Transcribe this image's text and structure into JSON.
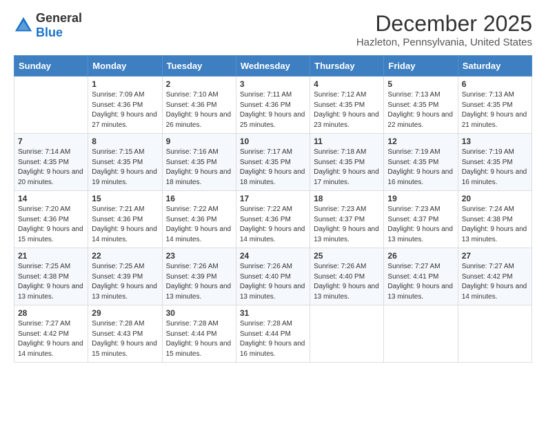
{
  "logo": {
    "general": "General",
    "blue": "Blue"
  },
  "title": "December 2025",
  "location": "Hazleton, Pennsylvania, United States",
  "days_of_week": [
    "Sunday",
    "Monday",
    "Tuesday",
    "Wednesday",
    "Thursday",
    "Friday",
    "Saturday"
  ],
  "weeks": [
    [
      {
        "day": "",
        "sunrise": "",
        "sunset": "",
        "daylight": ""
      },
      {
        "day": "1",
        "sunrise": "Sunrise: 7:09 AM",
        "sunset": "Sunset: 4:36 PM",
        "daylight": "Daylight: 9 hours and 27 minutes."
      },
      {
        "day": "2",
        "sunrise": "Sunrise: 7:10 AM",
        "sunset": "Sunset: 4:36 PM",
        "daylight": "Daylight: 9 hours and 26 minutes."
      },
      {
        "day": "3",
        "sunrise": "Sunrise: 7:11 AM",
        "sunset": "Sunset: 4:36 PM",
        "daylight": "Daylight: 9 hours and 25 minutes."
      },
      {
        "day": "4",
        "sunrise": "Sunrise: 7:12 AM",
        "sunset": "Sunset: 4:35 PM",
        "daylight": "Daylight: 9 hours and 23 minutes."
      },
      {
        "day": "5",
        "sunrise": "Sunrise: 7:13 AM",
        "sunset": "Sunset: 4:35 PM",
        "daylight": "Daylight: 9 hours and 22 minutes."
      },
      {
        "day": "6",
        "sunrise": "Sunrise: 7:13 AM",
        "sunset": "Sunset: 4:35 PM",
        "daylight": "Daylight: 9 hours and 21 minutes."
      }
    ],
    [
      {
        "day": "7",
        "sunrise": "Sunrise: 7:14 AM",
        "sunset": "Sunset: 4:35 PM",
        "daylight": "Daylight: 9 hours and 20 minutes."
      },
      {
        "day": "8",
        "sunrise": "Sunrise: 7:15 AM",
        "sunset": "Sunset: 4:35 PM",
        "daylight": "Daylight: 9 hours and 19 minutes."
      },
      {
        "day": "9",
        "sunrise": "Sunrise: 7:16 AM",
        "sunset": "Sunset: 4:35 PM",
        "daylight": "Daylight: 9 hours and 18 minutes."
      },
      {
        "day": "10",
        "sunrise": "Sunrise: 7:17 AM",
        "sunset": "Sunset: 4:35 PM",
        "daylight": "Daylight: 9 hours and 18 minutes."
      },
      {
        "day": "11",
        "sunrise": "Sunrise: 7:18 AM",
        "sunset": "Sunset: 4:35 PM",
        "daylight": "Daylight: 9 hours and 17 minutes."
      },
      {
        "day": "12",
        "sunrise": "Sunrise: 7:19 AM",
        "sunset": "Sunset: 4:35 PM",
        "daylight": "Daylight: 9 hours and 16 minutes."
      },
      {
        "day": "13",
        "sunrise": "Sunrise: 7:19 AM",
        "sunset": "Sunset: 4:35 PM",
        "daylight": "Daylight: 9 hours and 16 minutes."
      }
    ],
    [
      {
        "day": "14",
        "sunrise": "Sunrise: 7:20 AM",
        "sunset": "Sunset: 4:36 PM",
        "daylight": "Daylight: 9 hours and 15 minutes."
      },
      {
        "day": "15",
        "sunrise": "Sunrise: 7:21 AM",
        "sunset": "Sunset: 4:36 PM",
        "daylight": "Daylight: 9 hours and 14 minutes."
      },
      {
        "day": "16",
        "sunrise": "Sunrise: 7:22 AM",
        "sunset": "Sunset: 4:36 PM",
        "daylight": "Daylight: 9 hours and 14 minutes."
      },
      {
        "day": "17",
        "sunrise": "Sunrise: 7:22 AM",
        "sunset": "Sunset: 4:36 PM",
        "daylight": "Daylight: 9 hours and 14 minutes."
      },
      {
        "day": "18",
        "sunrise": "Sunrise: 7:23 AM",
        "sunset": "Sunset: 4:37 PM",
        "daylight": "Daylight: 9 hours and 13 minutes."
      },
      {
        "day": "19",
        "sunrise": "Sunrise: 7:23 AM",
        "sunset": "Sunset: 4:37 PM",
        "daylight": "Daylight: 9 hours and 13 minutes."
      },
      {
        "day": "20",
        "sunrise": "Sunrise: 7:24 AM",
        "sunset": "Sunset: 4:38 PM",
        "daylight": "Daylight: 9 hours and 13 minutes."
      }
    ],
    [
      {
        "day": "21",
        "sunrise": "Sunrise: 7:25 AM",
        "sunset": "Sunset: 4:38 PM",
        "daylight": "Daylight: 9 hours and 13 minutes."
      },
      {
        "day": "22",
        "sunrise": "Sunrise: 7:25 AM",
        "sunset": "Sunset: 4:39 PM",
        "daylight": "Daylight: 9 hours and 13 minutes."
      },
      {
        "day": "23",
        "sunrise": "Sunrise: 7:26 AM",
        "sunset": "Sunset: 4:39 PM",
        "daylight": "Daylight: 9 hours and 13 minutes."
      },
      {
        "day": "24",
        "sunrise": "Sunrise: 7:26 AM",
        "sunset": "Sunset: 4:40 PM",
        "daylight": "Daylight: 9 hours and 13 minutes."
      },
      {
        "day": "25",
        "sunrise": "Sunrise: 7:26 AM",
        "sunset": "Sunset: 4:40 PM",
        "daylight": "Daylight: 9 hours and 13 minutes."
      },
      {
        "day": "26",
        "sunrise": "Sunrise: 7:27 AM",
        "sunset": "Sunset: 4:41 PM",
        "daylight": "Daylight: 9 hours and 13 minutes."
      },
      {
        "day": "27",
        "sunrise": "Sunrise: 7:27 AM",
        "sunset": "Sunset: 4:42 PM",
        "daylight": "Daylight: 9 hours and 14 minutes."
      }
    ],
    [
      {
        "day": "28",
        "sunrise": "Sunrise: 7:27 AM",
        "sunset": "Sunset: 4:42 PM",
        "daylight": "Daylight: 9 hours and 14 minutes."
      },
      {
        "day": "29",
        "sunrise": "Sunrise: 7:28 AM",
        "sunset": "Sunset: 4:43 PM",
        "daylight": "Daylight: 9 hours and 15 minutes."
      },
      {
        "day": "30",
        "sunrise": "Sunrise: 7:28 AM",
        "sunset": "Sunset: 4:44 PM",
        "daylight": "Daylight: 9 hours and 15 minutes."
      },
      {
        "day": "31",
        "sunrise": "Sunrise: 7:28 AM",
        "sunset": "Sunset: 4:44 PM",
        "daylight": "Daylight: 9 hours and 16 minutes."
      },
      {
        "day": "",
        "sunrise": "",
        "sunset": "",
        "daylight": ""
      },
      {
        "day": "",
        "sunrise": "",
        "sunset": "",
        "daylight": ""
      },
      {
        "day": "",
        "sunrise": "",
        "sunset": "",
        "daylight": ""
      }
    ]
  ]
}
